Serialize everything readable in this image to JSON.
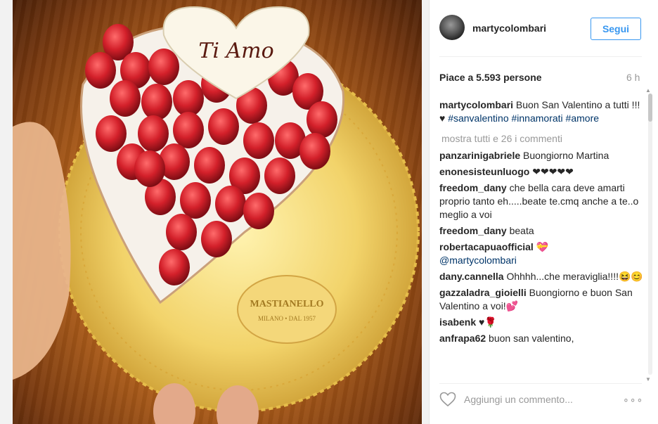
{
  "post": {
    "username": "martycolombari",
    "follow_label": "Segui",
    "likes_text": "Piace a 5.593 persone",
    "time": "6 h"
  },
  "caption": {
    "username": "martycolombari",
    "text": " Buon San Valentino a tutti !!! ♥ ",
    "tags": [
      "#sanvalentino",
      "#innamorati",
      "#amore"
    ]
  },
  "show_all": "mostra tutti e 26 i commenti",
  "comments": [
    {
      "user": "panzarinigabriele",
      "text": " Buongiorno Martina"
    },
    {
      "user": "enonesisteunluogo",
      "text": " ❤❤❤❤❤"
    },
    {
      "user": "freedom_dany",
      "text": " che bella cara deve amarti proprio tanto eh.....beate te.cmq anche a te..o meglio a voi"
    },
    {
      "user": "freedom_dany",
      "text": " beata"
    },
    {
      "user": "robertacapuaofficial",
      "text": " 💝 ",
      "mention": "@martycolombari"
    },
    {
      "user": "dany.cannella",
      "text": " Ohhhh...che meraviglia!!!!😆😊"
    },
    {
      "user": "gazzaladra_gioielli",
      "text": " Buongiorno e buon San Valentino a voi!💕"
    },
    {
      "user": "isabenk",
      "text": " ♥🌹"
    },
    {
      "user": "anfrapa62",
      "text": " buon san valentino,"
    }
  ],
  "footer": {
    "placeholder": "Aggiungi un commento...",
    "more": "∘∘∘"
  },
  "photo_text": {
    "topper": "Ti Amo",
    "brand": "MASTIANELLO",
    "brand_sub": "MILANO • DAL 1957"
  },
  "icons": {
    "like": "heart-outline-icon",
    "more": "more-options-icon"
  },
  "colors": {
    "accent": "#3897f0",
    "hashtag": "#003569",
    "muted": "#999999"
  }
}
